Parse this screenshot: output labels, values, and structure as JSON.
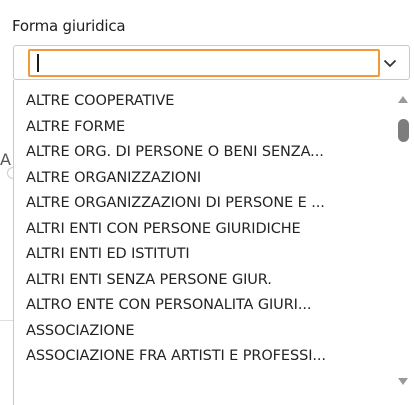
{
  "field": {
    "label": "Forma giuridica",
    "search_value": "",
    "toggle_icon": "chevron-down-icon"
  },
  "background": {
    "peek_letter": "A"
  },
  "options": [
    "ALTRE COOPERATIVE",
    "ALTRE FORME",
    "ALTRE ORG. DI PERSONE O BENI SENZA...",
    "ALTRE ORGANIZZAZIONI",
    "ALTRE ORGANIZZAZIONI DI PERSONE E ...",
    "ALTRI ENTI CON PERSONE GIURIDICHE",
    "ALTRI ENTI ED ISTITUTI",
    "ALTRI ENTI SENZA PERSONE GIUR.",
    "ALTRO ENTE CON PERSONALITA GIURI...",
    "ASSOCIAZIONE",
    "ASSOCIAZIONE FRA ARTISTI E PROFESSI..."
  ],
  "colors": {
    "focus_border": "#f29a38",
    "scroll_thumb": "#7d7d7d",
    "scroll_arrow": "#9a9a9a"
  }
}
